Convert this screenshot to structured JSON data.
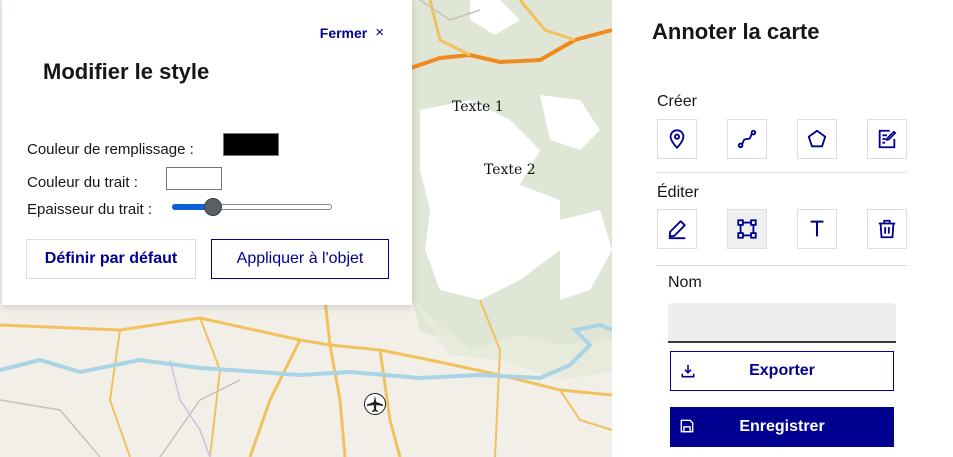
{
  "map": {
    "labels": [
      "Texte 1",
      "Texte 2"
    ]
  },
  "style_panel": {
    "close_label": "Fermer",
    "close_glyph": "×",
    "title": "Modifier le style",
    "fill_label": "Couleur de remplissage :",
    "stroke_label": "Couleur du trait :",
    "width_label": "Epaisseur du trait :",
    "fill_color": "#000000",
    "stroke_color": "#ffffff",
    "stroke_width_fraction": 0.25,
    "default_button": "Définir par défaut",
    "apply_button": "Appliquer à l'objet"
  },
  "sidebar": {
    "title": "Annoter la carte",
    "create_label": "Créer",
    "edit_label": "Éditer",
    "create_tools": [
      "marker-icon",
      "line-icon",
      "polygon-icon",
      "note-icon"
    ],
    "edit_tools": [
      "pencil-icon",
      "select-shape-icon",
      "text-icon",
      "trash-icon"
    ],
    "active_tool": "select-shape-icon",
    "name_label": "Nom",
    "name_value": "",
    "export_button": "Exporter",
    "save_button": "Enregistrer"
  },
  "colors": {
    "accent": "#000091",
    "map_green": "#dfe6d5",
    "road_yellow": "#f1c15e",
    "road_orange": "#ef8a1f",
    "river_blue": "#a8d4e6"
  }
}
